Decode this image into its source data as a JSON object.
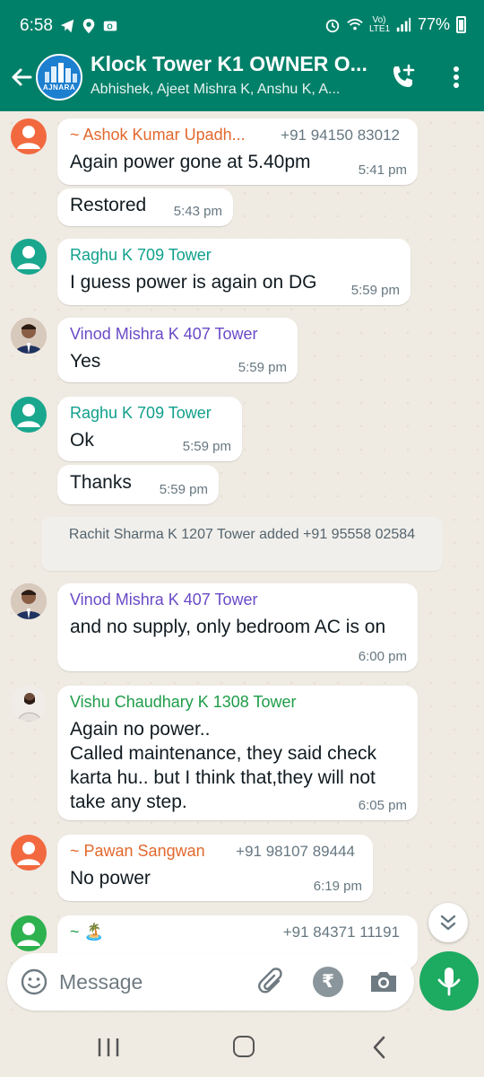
{
  "status_bar": {
    "time": "6:58",
    "network_label": "Vo) LTE1",
    "battery": "77%"
  },
  "header": {
    "title": "Klock Tower K1 OWNER O...",
    "subtitle": "Abhishek, Ajeet Mishra K, Anshu K, A...",
    "avatar_brand": "AJNARA",
    "add_call_icon": "add-call-icon",
    "menu_icon": "more-vert-icon"
  },
  "messages": [
    {
      "sender": "~ Ashok Kumar Upadh...",
      "phone": "+91 94150 83012",
      "text": "Again power gone at 5.40pm",
      "time": "5:41 pm",
      "sender_color": "#e3682d"
    },
    {
      "text": "Restored",
      "time": "5:43 pm"
    },
    {
      "sender": "Raghu K 709 Tower",
      "text": "I guess power is again on DG",
      "time": "5:59 pm",
      "sender_color": "#10a08c"
    },
    {
      "sender": "Vinod Mishra K 407 Tower",
      "text": "Yes",
      "time": "5:59 pm",
      "sender_color": "#6a4ac7"
    },
    {
      "sender": "Raghu K 709 Tower",
      "text": "Ok",
      "time": "5:59 pm",
      "sender_color": "#10a08c"
    },
    {
      "text": "Thanks",
      "time": "5:59 pm"
    },
    {
      "sender": "Vinod Mishra K 407 Tower",
      "text": "and no supply, only bedroom AC is on",
      "time": "6:00 pm",
      "sender_color": "#6a4ac7"
    },
    {
      "sender": "Vishu Chaudhary K 1308 Tower",
      "text_lines": [
        "Again no power..",
        "Called maintenance, they said check",
        "karta hu.. but I think that,they will not",
        "take any step."
      ],
      "time": "6:05 pm",
      "sender_color": "#1e9c48"
    },
    {
      "sender": "~ Pawan Sangwan",
      "phone": "+91 98107 89444",
      "text": "No  power",
      "time": "6:19 pm",
      "sender_color": "#e3682d"
    },
    {
      "sender": "~ 🏝️",
      "phone": "+91 84371 11191",
      "sender_color": "#1e9c48"
    }
  ],
  "system_message": "Rachit Sharma K 1207 Tower added +91 95558 02584",
  "input": {
    "placeholder": "Message",
    "value": "",
    "rupee_symbol": "₹"
  },
  "colors": {
    "header_bg": "#008069",
    "chat_bg": "#efeae2",
    "mic_bg": "#1daa61"
  }
}
